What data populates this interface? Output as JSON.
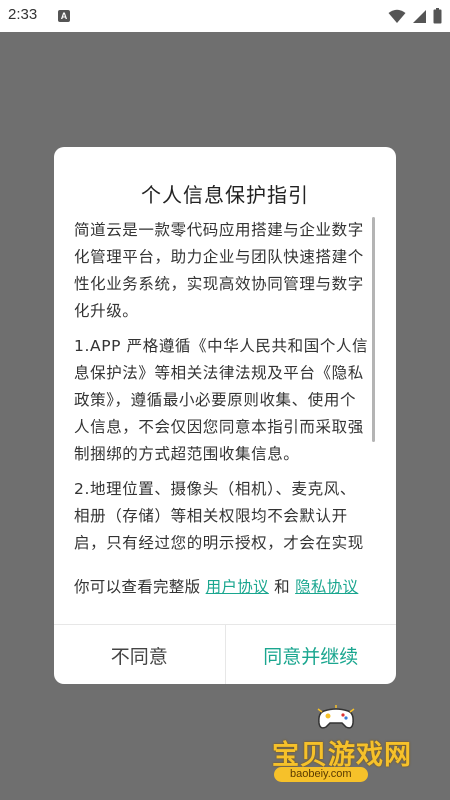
{
  "statusbar": {
    "time": "2:33",
    "notification_badge": "A",
    "icons": [
      "wifi-icon",
      "signal-icon",
      "battery-icon"
    ]
  },
  "dialog": {
    "title": "个人信息保护指引",
    "paragraphs": [
      "简道云是一款零代码应用搭建与企业数字化管理平台，助力企业与团队快速搭建个性化业务系统，实现高效协同管理与数字化升级。",
      "1.APP 严格遵循《中华人民共和国个人信息保护法》等相关法律法规及平台《隐私政策》，遵循最小必要原则收集、使用个人信息，不会仅因您同意本指引而采取强制捆绑的方式超范围收集信息。",
      "2.地理位置、摄像头（相机）、麦克风、相册（存储）等相关权限均不会默认开启，只有经过您的明示授权，才会在实现功能或服务时使用。"
    ],
    "agreements": {
      "prefix": "你可以查看完整版",
      "user_agreement": "用户协议",
      "conjunction": "和",
      "privacy_policy": "隐私协议"
    },
    "buttons": {
      "disagree": "不同意",
      "agree": "同意并继续"
    }
  },
  "watermark": {
    "title": "宝贝游戏网",
    "url": "baobeiy.com"
  },
  "colors": {
    "accent": "#1aa68f",
    "backdrop": "#6f6f6f",
    "watermark": "#f6c12a"
  }
}
